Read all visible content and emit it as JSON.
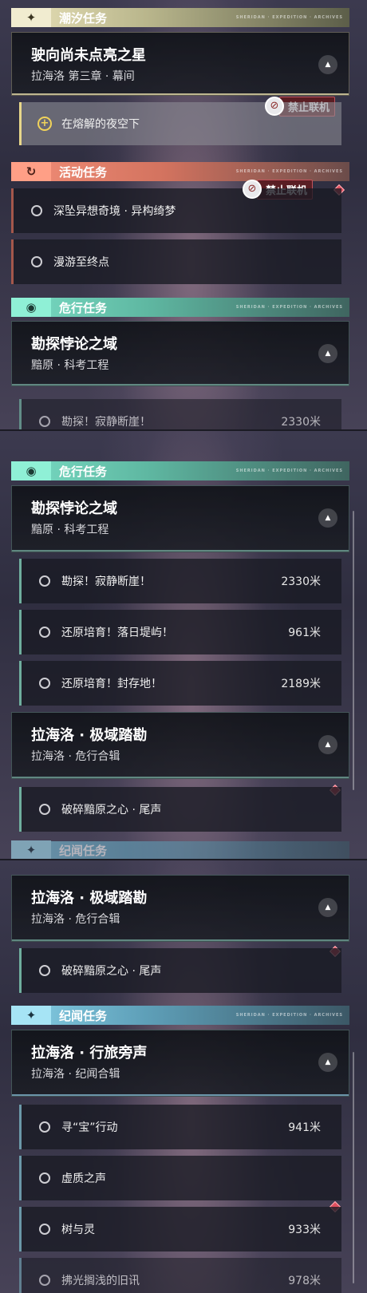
{
  "panel1": {
    "tide": {
      "header": "潮汐任务",
      "icon": "sparkle-icon",
      "deco": "SHERIDAN · EXPEDITION · ARCHIVES",
      "quest": {
        "title": "驶向尚未点亮之星",
        "subtitle": "拉海洛 第三章 · 幕间"
      },
      "badge": "禁止联机",
      "task": "在熔解的夜空下"
    },
    "event": {
      "header": "活动任务",
      "icon": "refresh-icon",
      "deco": "SHERIDAN · EXPEDITION · ARCHIVES",
      "badge": "禁止联机",
      "tasks": [
        "深坠异想奇境 · 异构绮梦",
        "漫游至终点"
      ]
    },
    "danger": {
      "header": "危行任务",
      "icon": "eye-icon",
      "deco": "SHERIDAN · EXPEDITION · ARCHIVES",
      "quest": {
        "title": "勘探悖论之域",
        "subtitle": "黯原 · 科考工程"
      },
      "peek_label": "勘探！寂静断崖！",
      "peek_dist": "2330米"
    }
  },
  "panel2": {
    "danger": {
      "header": "危行任务",
      "icon": "eye-icon",
      "deco": "SHERIDAN · EXPEDITION · ARCHIVES",
      "quest": {
        "title": "勘探悖论之域",
        "subtitle": "黯原 · 科考工程"
      },
      "tasks": [
        {
          "label": "勘探！寂静断崖！",
          "dist": "2330米"
        },
        {
          "label": "还原培育！落日堤屿！",
          "dist": "961米"
        },
        {
          "label": "还原培育！封存地！",
          "dist": "2189米"
        }
      ],
      "quest2": {
        "title": "拉海洛 · 极域踏勘",
        "subtitle": "拉海洛 · 危行合辑"
      },
      "task2": "破碎黯原之心 · 尾声",
      "peek_header": "纪闻任务"
    }
  },
  "panel3": {
    "danger_quest": {
      "title": "拉海洛 · 极域踏勘",
      "subtitle": "拉海洛 · 危行合辑"
    },
    "danger_task": "破碎黯原之心 · 尾声",
    "lore": {
      "header": "纪闻任务",
      "icon": "sparkle-icon",
      "deco": "SHERIDAN · EXPEDITION · ARCHIVES",
      "quest": {
        "title": "拉海洛 · 行旅旁声",
        "subtitle": "拉海洛 · 纪闻合辑"
      },
      "tasks": [
        {
          "label": "寻“宝”行动",
          "dist": "941米"
        },
        {
          "label": "虚质之声",
          "dist": ""
        },
        {
          "label": "树与灵",
          "dist": "933米"
        }
      ],
      "peek_label": "拂光搁浅的旧讯",
      "peek_dist": "978米"
    }
  },
  "colors": {
    "tide": "#e9e2b9",
    "event": "#f28e78",
    "danger": "#79dcc4",
    "lore": "#86cfe6",
    "alert": "#e0505f"
  }
}
